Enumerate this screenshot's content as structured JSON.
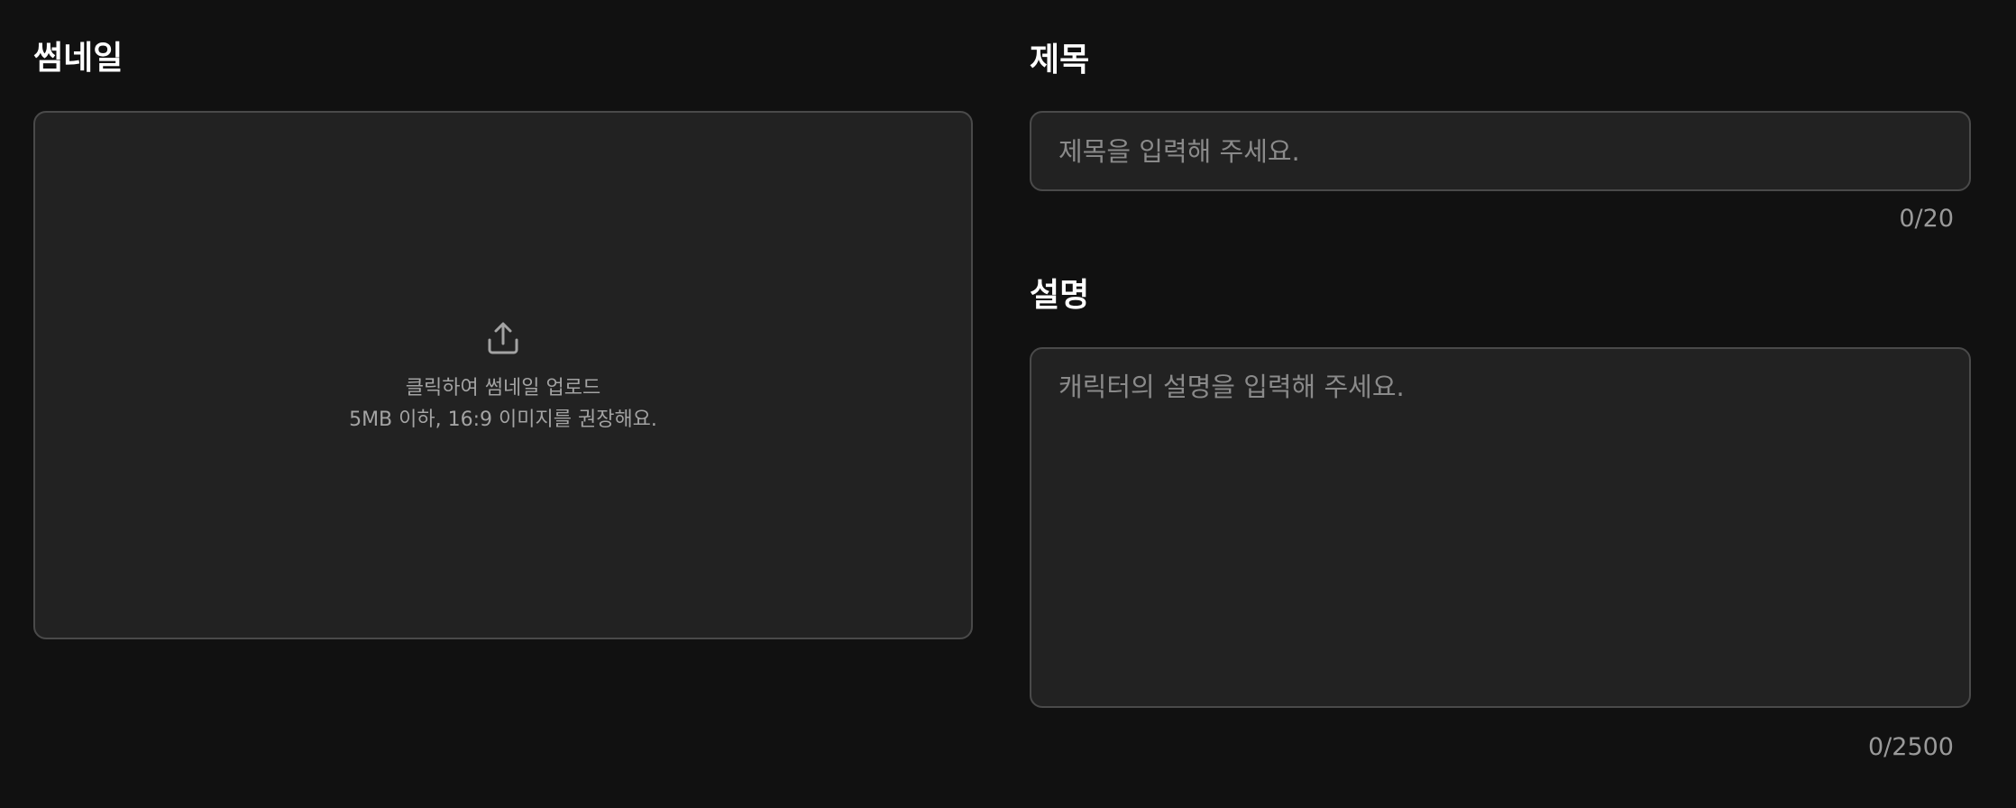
{
  "thumbnail": {
    "label": "썸네일",
    "icon": "upload-icon",
    "upload_text": "클릭하여 썸네일 업로드",
    "hint_text": "5MB 이하, 16:9 이미지를 권장해요."
  },
  "title_field": {
    "label": "제목",
    "value": "",
    "placeholder": "제목을 입력해 주세요.",
    "counter": "0/20"
  },
  "description_field": {
    "label": "설명",
    "value": "",
    "placeholder": "캐릭터의 설명을 입력해 주세요.",
    "counter": "0/2500"
  },
  "colors": {
    "background": "#111111",
    "panel": "#222222",
    "border": "#4a4a4a",
    "placeholder": "#8a8a8a",
    "muted_text": "#a3a3a3"
  }
}
